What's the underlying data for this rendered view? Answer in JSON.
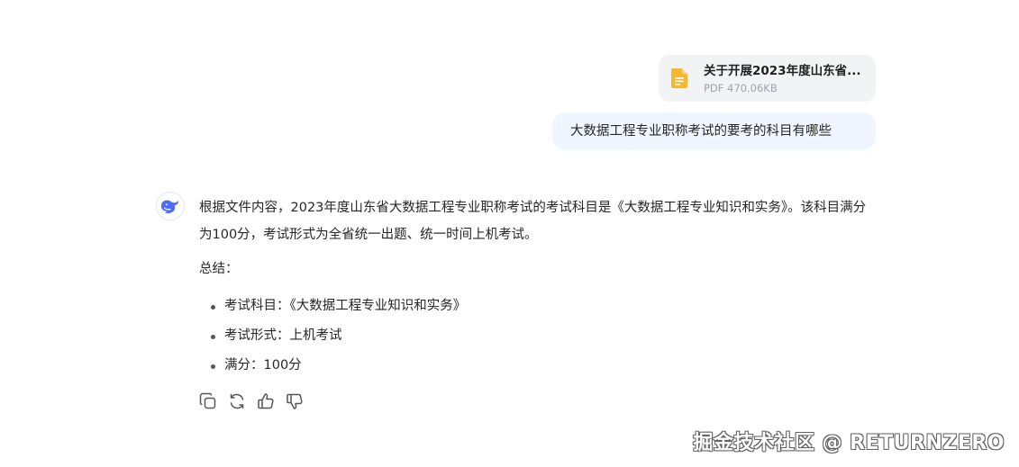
{
  "attachment": {
    "file_name": "关于开展2023年度山东省...",
    "file_meta": "PDF 470.06KB",
    "icon": "document-icon"
  },
  "user_message": "大数据工程专业职称考试的要考的科目有哪些",
  "assistant": {
    "avatar_icon": "whale-logo-icon",
    "paragraph_1": "根据文件内容，2023年度山东省大数据工程专业职称考试的考试科目是《大数据工程专业知识和实务》。该科目满分为100分，考试形式为全省统一出题、统一时间上机考试。",
    "summary_label": "总结：",
    "bullets": [
      "考试科目：《大数据工程专业知识和实务》",
      "考试形式：上机考试",
      "满分：100分"
    ]
  },
  "actions": {
    "copy": "copy-icon",
    "regenerate": "regenerate-icon",
    "like": "thumbs-up-icon",
    "dislike": "thumbs-down-icon"
  },
  "watermark": "掘金技术社区 @ RETURNZERO",
  "colors": {
    "file_icon": "#f5b82e",
    "user_bubble_bg": "#eff6ff",
    "brand_blue": "#4d6bfe"
  }
}
